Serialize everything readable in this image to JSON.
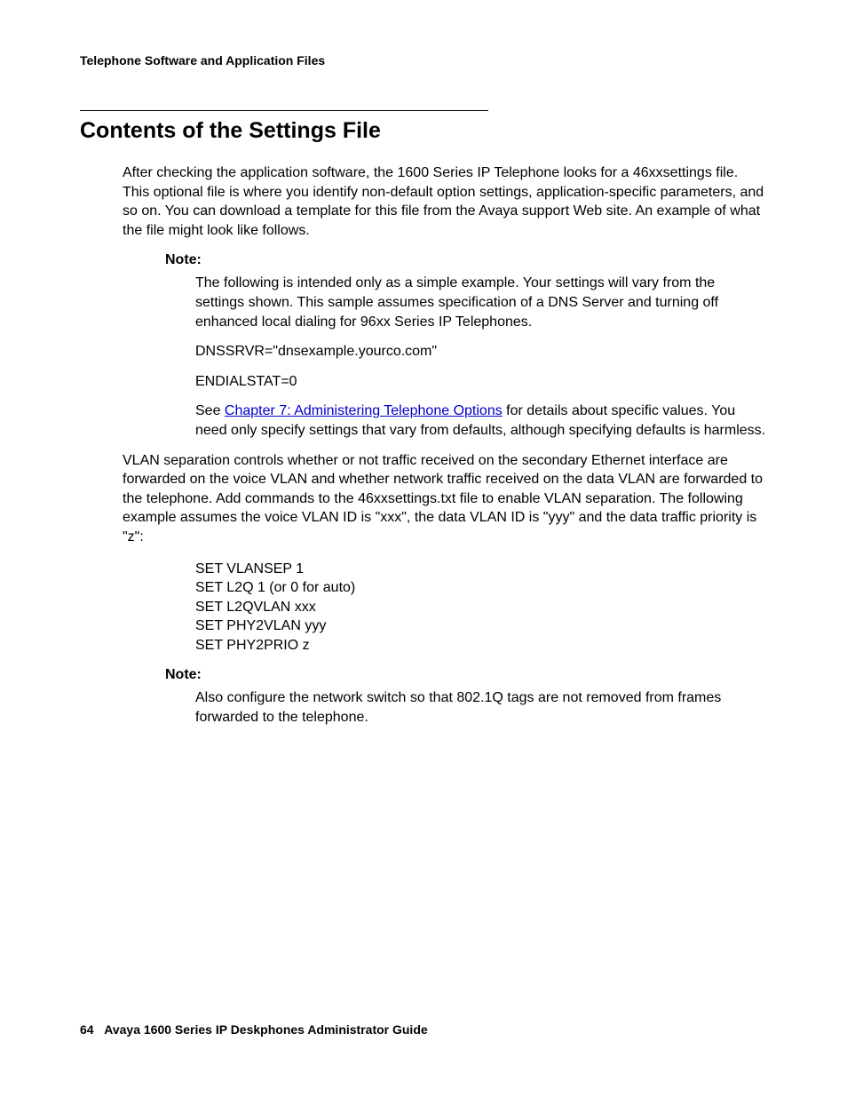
{
  "header": {
    "running": "Telephone Software and Application Files"
  },
  "section": {
    "title": "Contents of the Settings File",
    "intro": "After checking the application software, the 1600 Series IP Telephone looks for a 46xxsettings file. This optional file is where you identify non-default option settings, application-specific parameters, and so on. You can download a template for this file from the Avaya support Web site. An example of what the file might look like follows.",
    "note1_label": "Note:",
    "note1_body": "The following is intended only as a simple example. Your settings will vary from the settings shown. This sample assumes specification of a DNS Server and turning off enhanced local dialing for 96xx Series IP Telephones.",
    "example1_line1": "DNSSRVR=\"dnsexample.yourco.com\"",
    "example1_line2": "ENDIALSTAT=0",
    "see_prefix": "See ",
    "see_link": "Chapter 7: Administering Telephone Options",
    "see_suffix": " for details about specific values. You need only specify settings that vary from defaults, although specifying defaults is harmless.",
    "vlan_para": "VLAN separation controls whether or not traffic received on the secondary Ethernet interface are forwarded on the voice VLAN and whether network traffic received on the data VLAN are forwarded to the telephone. Add commands to the 46xxsettings.txt file to enable VLAN separation. The following example assumes the voice VLAN ID is \"xxx\", the data VLAN ID is \"yyy\" and the data traffic priority is \"z\":",
    "vlan_code": "SET VLANSEP 1\nSET L2Q 1 (or 0 for auto)\nSET L2QVLAN xxx\nSET PHY2VLAN yyy\nSET PHY2PRIO z",
    "note2_label": "Note:",
    "note2_body": "Also configure the network switch so that 802.1Q tags are not removed from frames forwarded to the telephone."
  },
  "footer": {
    "page_num": "64",
    "doc_title": "Avaya 1600 Series IP Deskphones Administrator Guide"
  }
}
